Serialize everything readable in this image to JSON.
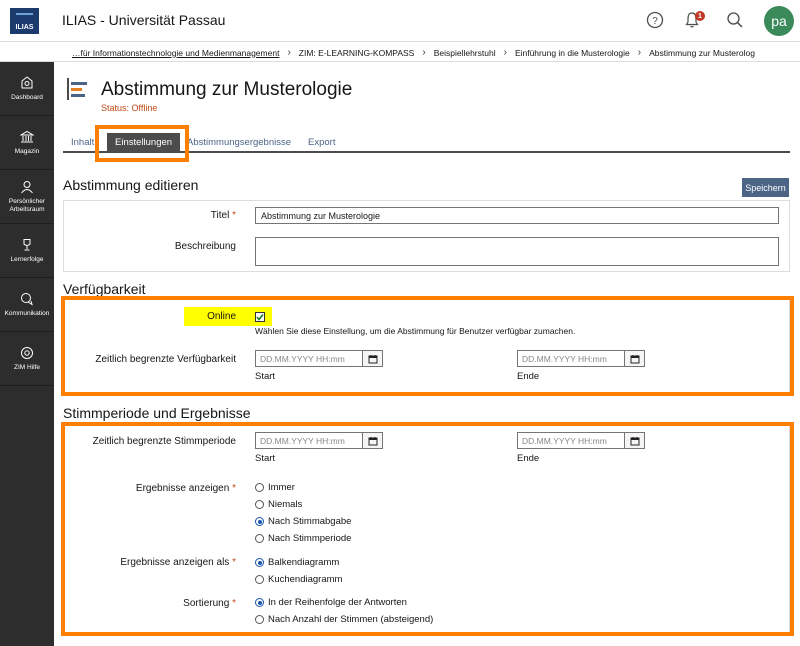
{
  "app": {
    "logo_text": "ILIAS",
    "title": "ILIAS - Universität Passau",
    "notification_count": "1",
    "avatar_initials": "pa"
  },
  "breadcrumb": [
    "…für Informationstechnologie und Medienmanagement",
    "ZIM: E-LEARNING-KOMPASS",
    "Beispiellehrstuhl",
    "Einführung in die Musterologie",
    "Abstimmung zur Musterolog"
  ],
  "sidebar": [
    {
      "label": "Dashboard"
    },
    {
      "label": "Magazin"
    },
    {
      "label": "Persönlicher Arbeitsraum"
    },
    {
      "label": "Lernerfolge"
    },
    {
      "label": "Kommunikation"
    },
    {
      "label": "ZIM Hilfe"
    }
  ],
  "page": {
    "title": "Abstimmung zur Musterologie",
    "status": "Status: Offline"
  },
  "tabs": [
    "Inhalt",
    "Einstellungen",
    "Abstimmungsergebnisse",
    "Export"
  ],
  "edit": {
    "section_title": "Abstimmung editieren",
    "save_label": "Speichern",
    "title_label": "Titel",
    "title_value": "Abstimmung zur Musterologie",
    "description_label": "Beschreibung",
    "description_value": ""
  },
  "availability": {
    "section_title": "Verfügbarkeit",
    "online_label": "Online",
    "online_checked": true,
    "online_hint": "Wählen Sie diese Einstellung, um die Abstimmung für Benutzer verfügbar zumachen.",
    "limited_label": "Zeitlich begrenzte Verfügbarkeit",
    "date_placeholder": "DD.MM.YYYY HH:mm",
    "start_label": "Start",
    "end_label": "Ende"
  },
  "voting": {
    "section_title": "Stimmperiode und Ergebnisse",
    "limited_label": "Zeitlich begrenzte Stimmperiode",
    "date_placeholder": "DD.MM.YYYY HH:mm",
    "start_label": "Start",
    "end_label": "Ende",
    "show_results_label": "Ergebnisse anzeigen",
    "show_results_options": [
      "Immer",
      "Niemals",
      "Nach Stimmabgabe",
      "Nach Stimmperiode"
    ],
    "show_results_selected": "Nach Stimmabgabe",
    "show_as_label": "Ergebnisse anzeigen als",
    "show_as_options": [
      "Balkendiagramm",
      "Kuchendiagramm"
    ],
    "show_as_selected": "Balkendiagramm",
    "sort_label": "Sortierung",
    "sort_options": [
      "In der Reihenfolge der Antworten",
      "Nach Anzahl der Stimmen (absteigend)"
    ],
    "sort_selected": "In der Reihenfolge der Antworten"
  },
  "colors": {
    "accent": "#4c6586",
    "highlight": "#ff8000",
    "status": "#c04a17",
    "sidebar": "#2d2d2d"
  }
}
